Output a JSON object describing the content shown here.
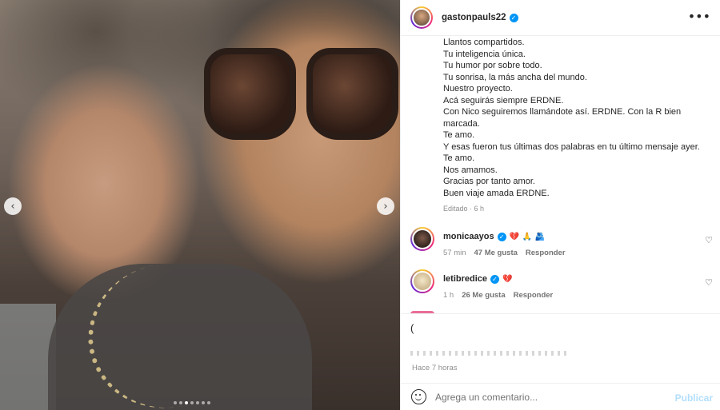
{
  "media": {
    "prev_icon": "chevron-left-icon",
    "next_icon": "chevron-right-icon",
    "carousel_dots": 7,
    "active_dot": 2
  },
  "header": {
    "username": "gastonpauls22",
    "verified_icon": "verified-badge-icon",
    "more_icon": "more-horizontal-icon"
  },
  "caption": {
    "lines": [
      "Llantos compartidos.",
      "Tu inteligencia única.",
      "Tu humor por sobre todo.",
      "Tu sonrisa, la más ancha del mundo.",
      "Nuestro proyecto.",
      "Acá seguirás siempre ERDNE.",
      "Con Nico seguiremos llamándote así. ERDNE. Con la R bien",
      "marcada.",
      "Te amo.",
      "Y esas fueron tus últimas dos palabras en tu último mensaje ayer.",
      "Te amo.",
      "Nos amamos.",
      "Gracias por tanto amor.",
      "Buen viaje amada ERDNE."
    ],
    "edited": "Editado · 6 h"
  },
  "comments": [
    {
      "username": "monicaayos",
      "emojis": "💔 🙏 🫂",
      "time": "57 min",
      "likes": "47 Me gusta",
      "reply": "Responder"
    },
    {
      "username": "letibredice",
      "emojis": "💔",
      "time": "1 h",
      "likes": "26 Me gusta",
      "reply": "Responder"
    }
  ],
  "post": {
    "partial_text": "(",
    "time_ago": "Hace 7 horas"
  },
  "add_comment": {
    "placeholder": "Agrega un comentario...",
    "publish": "Publicar"
  },
  "colors": {
    "verified": "#0095f6",
    "publish_disabled": "#b2dffc",
    "muted": "#8e8e8e"
  }
}
